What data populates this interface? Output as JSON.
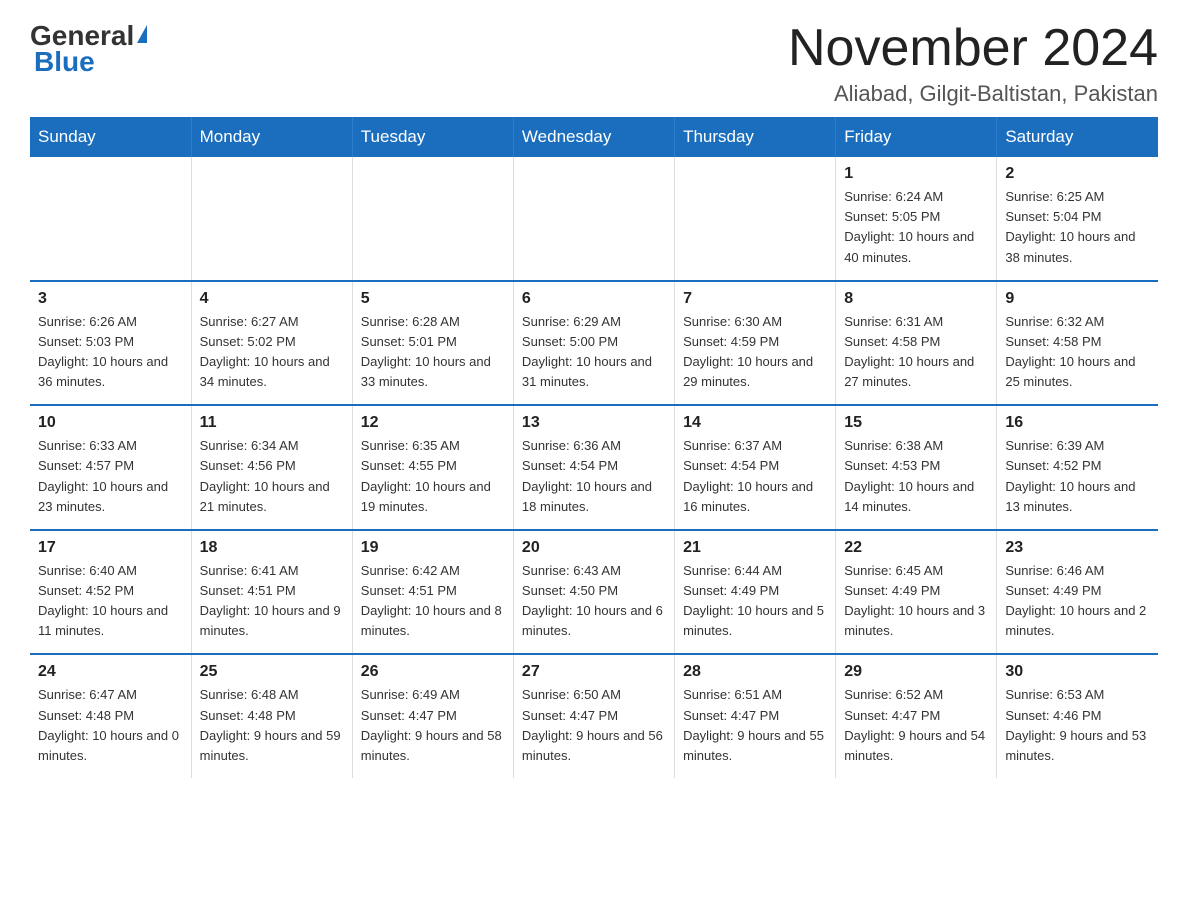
{
  "logo": {
    "general": "General",
    "blue": "Blue"
  },
  "title": "November 2024",
  "subtitle": "Aliabad, Gilgit-Baltistan, Pakistan",
  "days_of_week": [
    "Sunday",
    "Monday",
    "Tuesday",
    "Wednesday",
    "Thursday",
    "Friday",
    "Saturday"
  ],
  "weeks": [
    [
      {
        "day": "",
        "info": ""
      },
      {
        "day": "",
        "info": ""
      },
      {
        "day": "",
        "info": ""
      },
      {
        "day": "",
        "info": ""
      },
      {
        "day": "",
        "info": ""
      },
      {
        "day": "1",
        "info": "Sunrise: 6:24 AM\nSunset: 5:05 PM\nDaylight: 10 hours and 40 minutes."
      },
      {
        "day": "2",
        "info": "Sunrise: 6:25 AM\nSunset: 5:04 PM\nDaylight: 10 hours and 38 minutes."
      }
    ],
    [
      {
        "day": "3",
        "info": "Sunrise: 6:26 AM\nSunset: 5:03 PM\nDaylight: 10 hours and 36 minutes."
      },
      {
        "day": "4",
        "info": "Sunrise: 6:27 AM\nSunset: 5:02 PM\nDaylight: 10 hours and 34 minutes."
      },
      {
        "day": "5",
        "info": "Sunrise: 6:28 AM\nSunset: 5:01 PM\nDaylight: 10 hours and 33 minutes."
      },
      {
        "day": "6",
        "info": "Sunrise: 6:29 AM\nSunset: 5:00 PM\nDaylight: 10 hours and 31 minutes."
      },
      {
        "day": "7",
        "info": "Sunrise: 6:30 AM\nSunset: 4:59 PM\nDaylight: 10 hours and 29 minutes."
      },
      {
        "day": "8",
        "info": "Sunrise: 6:31 AM\nSunset: 4:58 PM\nDaylight: 10 hours and 27 minutes."
      },
      {
        "day": "9",
        "info": "Sunrise: 6:32 AM\nSunset: 4:58 PM\nDaylight: 10 hours and 25 minutes."
      }
    ],
    [
      {
        "day": "10",
        "info": "Sunrise: 6:33 AM\nSunset: 4:57 PM\nDaylight: 10 hours and 23 minutes."
      },
      {
        "day": "11",
        "info": "Sunrise: 6:34 AM\nSunset: 4:56 PM\nDaylight: 10 hours and 21 minutes."
      },
      {
        "day": "12",
        "info": "Sunrise: 6:35 AM\nSunset: 4:55 PM\nDaylight: 10 hours and 19 minutes."
      },
      {
        "day": "13",
        "info": "Sunrise: 6:36 AM\nSunset: 4:54 PM\nDaylight: 10 hours and 18 minutes."
      },
      {
        "day": "14",
        "info": "Sunrise: 6:37 AM\nSunset: 4:54 PM\nDaylight: 10 hours and 16 minutes."
      },
      {
        "day": "15",
        "info": "Sunrise: 6:38 AM\nSunset: 4:53 PM\nDaylight: 10 hours and 14 minutes."
      },
      {
        "day": "16",
        "info": "Sunrise: 6:39 AM\nSunset: 4:52 PM\nDaylight: 10 hours and 13 minutes."
      }
    ],
    [
      {
        "day": "17",
        "info": "Sunrise: 6:40 AM\nSunset: 4:52 PM\nDaylight: 10 hours and 11 minutes."
      },
      {
        "day": "18",
        "info": "Sunrise: 6:41 AM\nSunset: 4:51 PM\nDaylight: 10 hours and 9 minutes."
      },
      {
        "day": "19",
        "info": "Sunrise: 6:42 AM\nSunset: 4:51 PM\nDaylight: 10 hours and 8 minutes."
      },
      {
        "day": "20",
        "info": "Sunrise: 6:43 AM\nSunset: 4:50 PM\nDaylight: 10 hours and 6 minutes."
      },
      {
        "day": "21",
        "info": "Sunrise: 6:44 AM\nSunset: 4:49 PM\nDaylight: 10 hours and 5 minutes."
      },
      {
        "day": "22",
        "info": "Sunrise: 6:45 AM\nSunset: 4:49 PM\nDaylight: 10 hours and 3 minutes."
      },
      {
        "day": "23",
        "info": "Sunrise: 6:46 AM\nSunset: 4:49 PM\nDaylight: 10 hours and 2 minutes."
      }
    ],
    [
      {
        "day": "24",
        "info": "Sunrise: 6:47 AM\nSunset: 4:48 PM\nDaylight: 10 hours and 0 minutes."
      },
      {
        "day": "25",
        "info": "Sunrise: 6:48 AM\nSunset: 4:48 PM\nDaylight: 9 hours and 59 minutes."
      },
      {
        "day": "26",
        "info": "Sunrise: 6:49 AM\nSunset: 4:47 PM\nDaylight: 9 hours and 58 minutes."
      },
      {
        "day": "27",
        "info": "Sunrise: 6:50 AM\nSunset: 4:47 PM\nDaylight: 9 hours and 56 minutes."
      },
      {
        "day": "28",
        "info": "Sunrise: 6:51 AM\nSunset: 4:47 PM\nDaylight: 9 hours and 55 minutes."
      },
      {
        "day": "29",
        "info": "Sunrise: 6:52 AM\nSunset: 4:47 PM\nDaylight: 9 hours and 54 minutes."
      },
      {
        "day": "30",
        "info": "Sunrise: 6:53 AM\nSunset: 4:46 PM\nDaylight: 9 hours and 53 minutes."
      }
    ]
  ]
}
